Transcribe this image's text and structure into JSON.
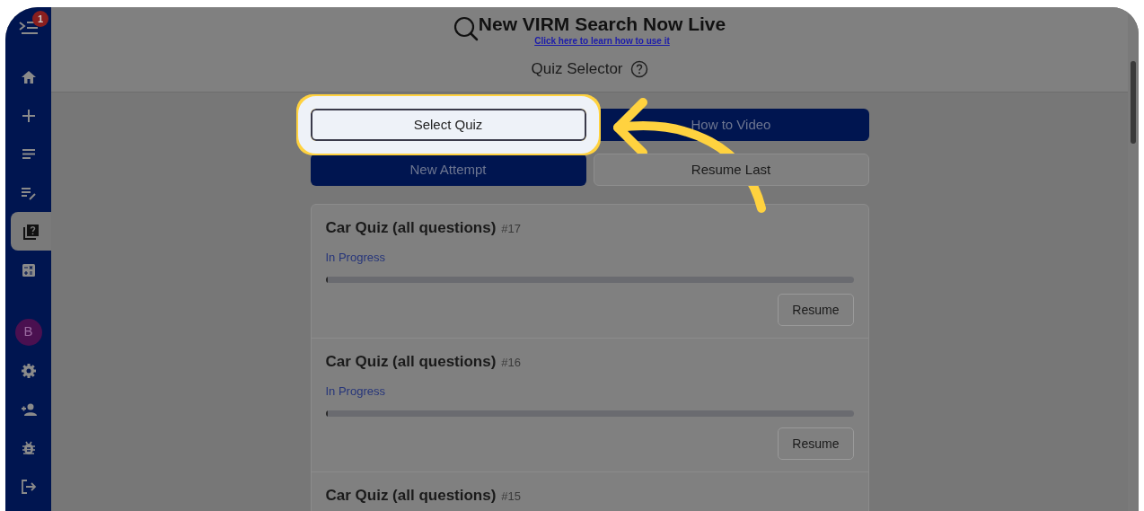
{
  "header": {
    "title": "New VIRM Search Now Live",
    "link": "Click here to learn how to use it"
  },
  "page_title": "Quiz Selector",
  "sidebar": {
    "badge": "1",
    "items": [
      {
        "kind": "home",
        "selected": false
      },
      {
        "kind": "plus",
        "selected": false
      },
      {
        "kind": "list",
        "selected": false
      },
      {
        "kind": "edit",
        "selected": false
      },
      {
        "kind": "quiz",
        "selected": true
      },
      {
        "kind": "calculator",
        "selected": false
      },
      {
        "kind": "avatar",
        "label": "B",
        "selected": false
      },
      {
        "kind": "settings",
        "selected": false
      },
      {
        "kind": "add-user",
        "selected": false
      },
      {
        "kind": "bug",
        "selected": false
      },
      {
        "kind": "logout",
        "selected": false
      }
    ]
  },
  "actions": [
    {
      "label": "Select Quiz",
      "kind": "light",
      "highlighted": true
    },
    {
      "label": "How to Video",
      "kind": "dark",
      "highlighted": false
    },
    {
      "label": "New Attempt",
      "kind": "dark",
      "highlighted": false
    },
    {
      "label": "Resume Last",
      "kind": "light",
      "highlighted": false
    }
  ],
  "attempts": [
    {
      "title": "Car Quiz (all questions)",
      "number": "#17",
      "status": "In Progress",
      "level": 0.004,
      "button": "Resume"
    },
    {
      "title": "Car Quiz (all questions)",
      "number": "#16",
      "status": "In Progress",
      "level": 0.004,
      "button": "Resume"
    },
    {
      "title": "Car Quiz (all questions)",
      "number": "#15"
    }
  ]
}
